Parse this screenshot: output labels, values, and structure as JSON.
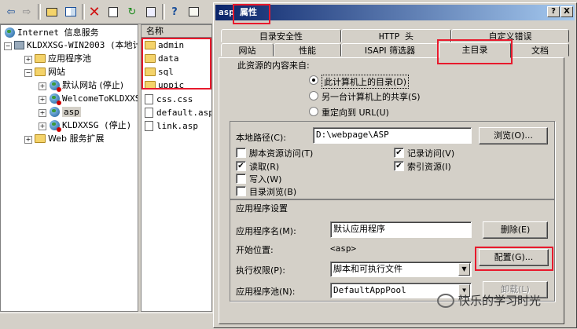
{
  "toolbar": {
    "icons": [
      "back-arrow-icon",
      "forward-arrow-icon",
      "up-folder-icon",
      "show-tree-icon",
      "delete-icon",
      "properties-icon",
      "refresh-icon",
      "export-icon",
      "help-icon",
      "view-icon",
      "play-icon",
      "stop-icon",
      "pause-icon"
    ]
  },
  "tree": {
    "root": "Internet 信息服务",
    "server": "KLDXXSG-WIN2003 (本地计",
    "app_pools": "应用程序池",
    "websites": "网站",
    "sites": [
      {
        "label": "默认网站 (停止)",
        "stopped": true
      },
      {
        "label": "WelcomeToKLDXXS",
        "stopped": true
      },
      {
        "label": "asp",
        "stopped": false
      },
      {
        "label": "KLDXXSG (停止)",
        "stopped": true
      }
    ],
    "web_ext": "Web 服务扩展"
  },
  "list": {
    "header": "名称",
    "folders": [
      "admin",
      "data",
      "sql",
      "uppic"
    ],
    "files": [
      "css.css",
      "default.asp",
      "link.asp"
    ]
  },
  "dialog": {
    "site_name": "asp",
    "title": "属性",
    "help_btn": "?",
    "close_btn": "X",
    "tabs_back": [
      "目录安全性",
      "HTTP 头",
      "自定义错误"
    ],
    "tabs_front": [
      "网站",
      "性能",
      "ISAPI 筛选器",
      "主目录",
      "文档"
    ],
    "active_tab": "主目录",
    "source_label": "此资源的内容来自:",
    "radios": [
      {
        "label": "此计算机上的目录(D)",
        "selected": true
      },
      {
        "label": "另一台计算机上的共享(S)",
        "selected": false
      },
      {
        "label": "重定向到 URL(U)",
        "selected": false
      }
    ],
    "local_path_label": "本地路径(C):",
    "local_path_value": "D:\\webpage\\ASP",
    "browse_btn": "浏览(O)...",
    "checks_left": [
      {
        "label": "脚本资源访问(T)",
        "checked": false
      },
      {
        "label": "读取(R)",
        "checked": true
      },
      {
        "label": "写入(W)",
        "checked": false
      },
      {
        "label": "目录浏览(B)",
        "checked": false
      }
    ],
    "checks_right": [
      {
        "label": "记录访问(V)",
        "checked": true
      },
      {
        "label": "索引资源(I)",
        "checked": true
      }
    ],
    "app_settings_label": "应用程序设置",
    "app_name_label": "应用程序名(M):",
    "app_name_value": "默认应用程序",
    "remove_btn": "删除(E)",
    "start_point_label": "开始位置:",
    "start_point_value": "<asp>",
    "config_btn": "配置(G)...",
    "exec_perm_label": "执行权限(P):",
    "exec_perm_value": "脚本和可执行文件",
    "app_pool_label": "应用程序池(N):",
    "app_pool_value": "DefaultAppPool",
    "unload_btn": "卸载(L)"
  },
  "watermark": "快乐的学习时光",
  "colors": {
    "highlight": "#e8192c",
    "titlebar": "#0a246a",
    "window": "#d4d0c8"
  }
}
